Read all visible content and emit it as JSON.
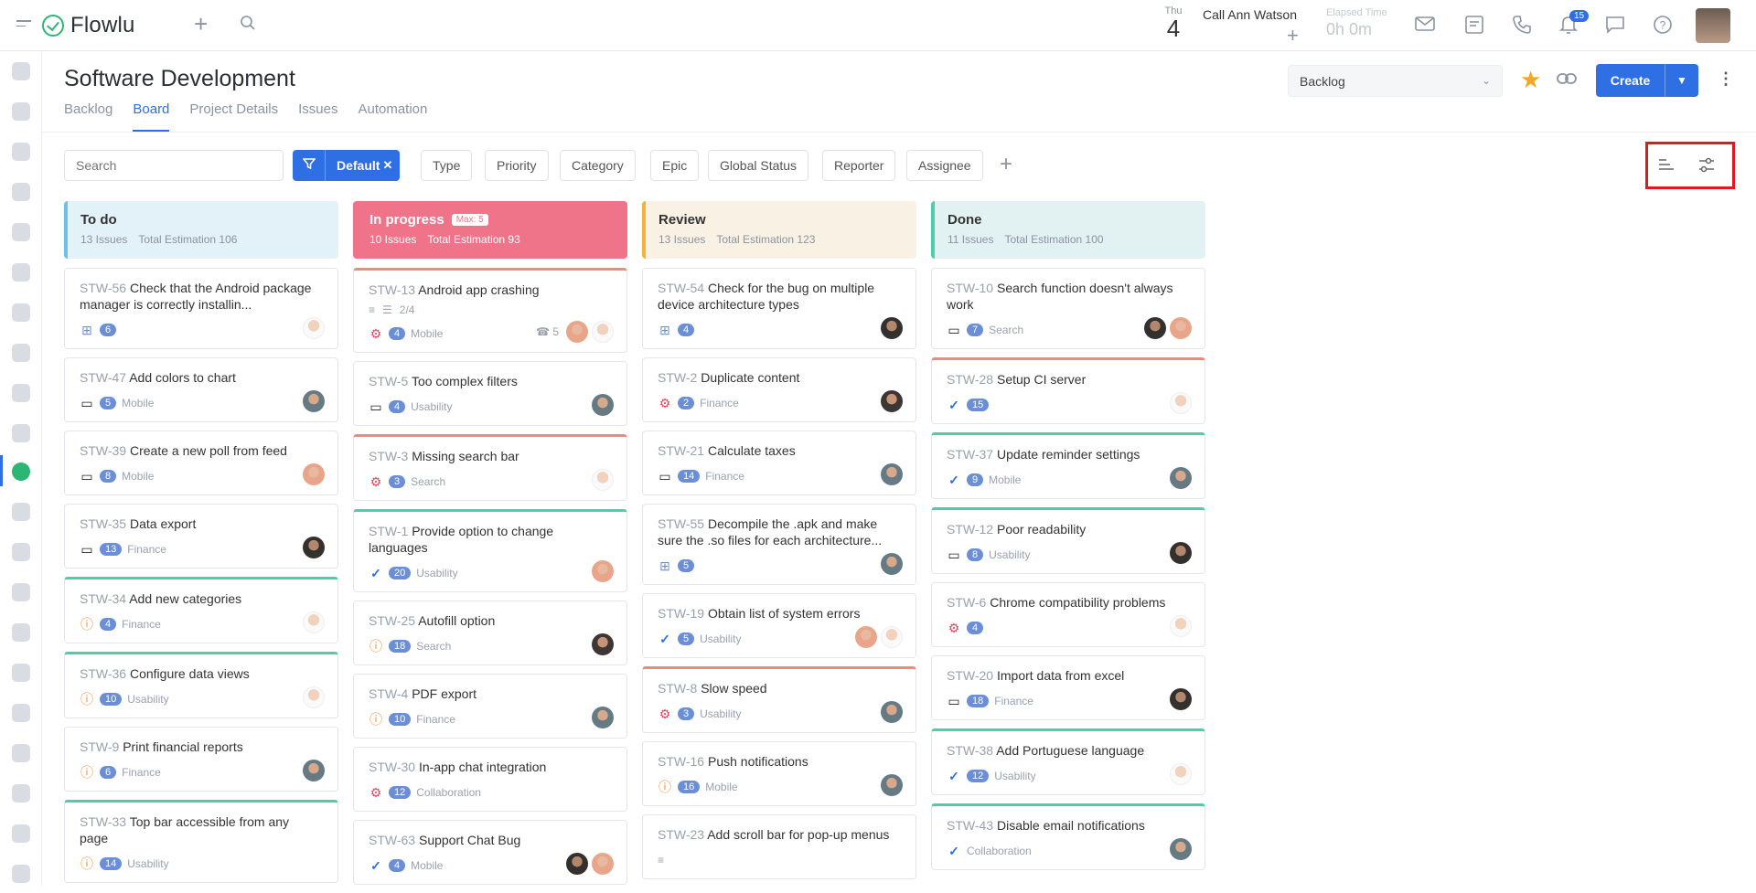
{
  "app": {
    "name": "Flowlu"
  },
  "topbar": {
    "dow": "Thu",
    "day": "4",
    "call": "Call Ann Watson",
    "elapsed_label": "Elapsed Time",
    "elapsed_value": "0h 0m",
    "notifications": "15"
  },
  "page": {
    "title": "Software Development",
    "tabs": [
      "Backlog",
      "Board",
      "Project Details",
      "Issues",
      "Automation"
    ],
    "active_tab": "Board",
    "backlog_select": "Backlog",
    "create_label": "Create"
  },
  "filters": {
    "search_placeholder": "Search",
    "default_label": "Default",
    "chips": [
      "Type",
      "Priority",
      "Category",
      "Epic",
      "Global Status",
      "Reporter",
      "Assignee"
    ]
  },
  "colors": {
    "accent": "#2f6fe4",
    "todo": "#e3f1f8",
    "progress": "#f07489",
    "review": "#f9f2e4",
    "done": "#e2f2f2"
  },
  "columns": [
    {
      "title": "To do",
      "issues": "13 Issues",
      "estimation": "Total Estimation 106",
      "cards": [
        {
          "key": "STW-56",
          "title": "Check that the Android package manager is correctly installin...",
          "icon": "tree",
          "count": "6",
          "tag": "",
          "avatars": [
            "a1"
          ],
          "top": ""
        },
        {
          "key": "STW-47",
          "title": "Add colors to chart",
          "icon": "bm",
          "count": "5",
          "tag": "Mobile",
          "avatars": [
            "a2"
          ],
          "top": ""
        },
        {
          "key": "STW-39",
          "title": "Create a new poll from feed",
          "icon": "bm",
          "count": "8",
          "tag": "Mobile",
          "avatars": [
            "a3"
          ],
          "top": ""
        },
        {
          "key": "STW-35",
          "title": "Data export",
          "icon": "bm",
          "count": "13",
          "tag": "Finance",
          "avatars": [
            "a4"
          ],
          "top": ""
        },
        {
          "key": "STW-34",
          "title": "Add new categories",
          "icon": "q",
          "count": "4",
          "tag": "Finance",
          "avatars": [
            "a1"
          ],
          "top": "green"
        },
        {
          "key": "STW-36",
          "title": "Configure data views",
          "icon": "q",
          "count": "10",
          "tag": "Usability",
          "avatars": [
            "a1"
          ],
          "top": "green"
        },
        {
          "key": "STW-9",
          "title": "Print financial reports",
          "icon": "q",
          "count": "6",
          "tag": "Finance",
          "avatars": [
            "a2"
          ],
          "top": ""
        },
        {
          "key": "STW-33",
          "title": "Top bar accessible from any page",
          "icon": "q",
          "count": "14",
          "tag": "Usability",
          "avatars": [],
          "top": "green"
        }
      ]
    },
    {
      "title": "In progress",
      "max": "Max: 5",
      "issues": "10 Issues",
      "estimation": "Total Estimation 93",
      "cards": [
        {
          "key": "STW-13",
          "title": "Android app crashing",
          "sub": "2/4",
          "icon": "bug",
          "count": "4",
          "tag": "Mobile",
          "phone": "5",
          "avatars": [
            "a3",
            "a1"
          ],
          "top": "red"
        },
        {
          "key": "STW-5",
          "title": "Too complex filters",
          "icon": "bm",
          "count": "4",
          "tag": "Usability",
          "avatars": [
            "a2"
          ],
          "top": ""
        },
        {
          "key": "STW-3",
          "title": "Missing search bar",
          "icon": "bug",
          "count": "3",
          "tag": "Search",
          "avatars": [
            "a1"
          ],
          "top": "red"
        },
        {
          "key": "STW-1",
          "title": "Provide option to change languages",
          "icon": "chk",
          "count": "20",
          "tag": "Usability",
          "avatars": [
            "a3"
          ],
          "top": "green"
        },
        {
          "key": "STW-25",
          "title": "Autofill option",
          "icon": "q",
          "count": "18",
          "tag": "Search",
          "avatars": [
            "a5"
          ],
          "top": ""
        },
        {
          "key": "STW-4",
          "title": "PDF export",
          "icon": "q",
          "count": "10",
          "tag": "Finance",
          "avatars": [
            "a2"
          ],
          "top": ""
        },
        {
          "key": "STW-30",
          "title": "In-app chat integration",
          "icon": "bug",
          "count": "12",
          "tag": "Collaboration",
          "avatars": [],
          "top": ""
        },
        {
          "key": "STW-63",
          "title": "Support Chat Bug",
          "icon": "chk",
          "count": "4",
          "tag": "Mobile",
          "avatars": [
            "a4",
            "a3"
          ],
          "top": ""
        }
      ]
    },
    {
      "title": "Review",
      "issues": "13 Issues",
      "estimation": "Total Estimation 123",
      "cards": [
        {
          "key": "STW-54",
          "title": "Check for the bug on multiple device architecture types",
          "icon": "tree",
          "count": "4",
          "tag": "",
          "avatars": [
            "a4"
          ],
          "top": ""
        },
        {
          "key": "STW-2",
          "title": "Duplicate content",
          "icon": "bug",
          "count": "2",
          "tag": "Finance",
          "avatars": [
            "a5"
          ],
          "top": ""
        },
        {
          "key": "STW-21",
          "title": "Calculate taxes",
          "icon": "bm",
          "count": "14",
          "tag": "Finance",
          "avatars": [
            "a2"
          ],
          "top": ""
        },
        {
          "key": "STW-55",
          "title": "Decompile the .apk and make sure the .so files for each architecture...",
          "icon": "tree",
          "count": "5",
          "tag": "",
          "avatars": [
            "a2"
          ],
          "top": ""
        },
        {
          "key": "STW-19",
          "title": "Obtain list of system errors",
          "icon": "chk",
          "count": "5",
          "tag": "Usability",
          "avatars": [
            "a3",
            "a1"
          ],
          "top": ""
        },
        {
          "key": "STW-8",
          "title": "Slow speed",
          "icon": "bug",
          "count": "3",
          "tag": "Usability",
          "avatars": [
            "a2"
          ],
          "top": "red"
        },
        {
          "key": "STW-16",
          "title": "Push notifications",
          "icon": "q",
          "count": "16",
          "tag": "Mobile",
          "avatars": [
            "a2"
          ],
          "top": ""
        },
        {
          "key": "STW-23",
          "title": "Add scroll bar for pop-up menus",
          "icon": "",
          "count": "",
          "tag": "",
          "avatars": [],
          "top": ""
        }
      ]
    },
    {
      "title": "Done",
      "issues": "11 Issues",
      "estimation": "Total Estimation 100",
      "cards": [
        {
          "key": "STW-10",
          "title": "Search function doesn't always work",
          "icon": "bm",
          "count": "7",
          "tag": "Search",
          "avatars": [
            "a4",
            "a3"
          ],
          "top": ""
        },
        {
          "key": "STW-28",
          "title": "Setup CI server",
          "icon": "chk",
          "count": "15",
          "tag": "",
          "avatars": [
            "a1"
          ],
          "top": "red"
        },
        {
          "key": "STW-37",
          "title": "Update reminder settings",
          "icon": "chk",
          "count": "9",
          "tag": "Mobile",
          "avatars": [
            "a2"
          ],
          "top": "green"
        },
        {
          "key": "STW-12",
          "title": "Poor readability",
          "icon": "bm",
          "count": "8",
          "tag": "Usability",
          "avatars": [
            "a4"
          ],
          "top": "green"
        },
        {
          "key": "STW-6",
          "title": "Chrome compatibility problems",
          "icon": "bug",
          "count": "4",
          "tag": "",
          "avatars": [
            "a1"
          ],
          "top": ""
        },
        {
          "key": "STW-20",
          "title": "Import data from excel",
          "icon": "bm",
          "count": "18",
          "tag": "Finance",
          "avatars": [
            "a4"
          ],
          "top": ""
        },
        {
          "key": "STW-38",
          "title": "Add Portuguese language",
          "icon": "chk",
          "count": "12",
          "tag": "Usability",
          "avatars": [
            "a1"
          ],
          "top": "green"
        },
        {
          "key": "STW-43",
          "title": "Disable email notifications",
          "icon": "chk",
          "count": "",
          "tag": "Collaboration",
          "avatars": [
            "a2"
          ],
          "top": "green"
        }
      ]
    }
  ]
}
